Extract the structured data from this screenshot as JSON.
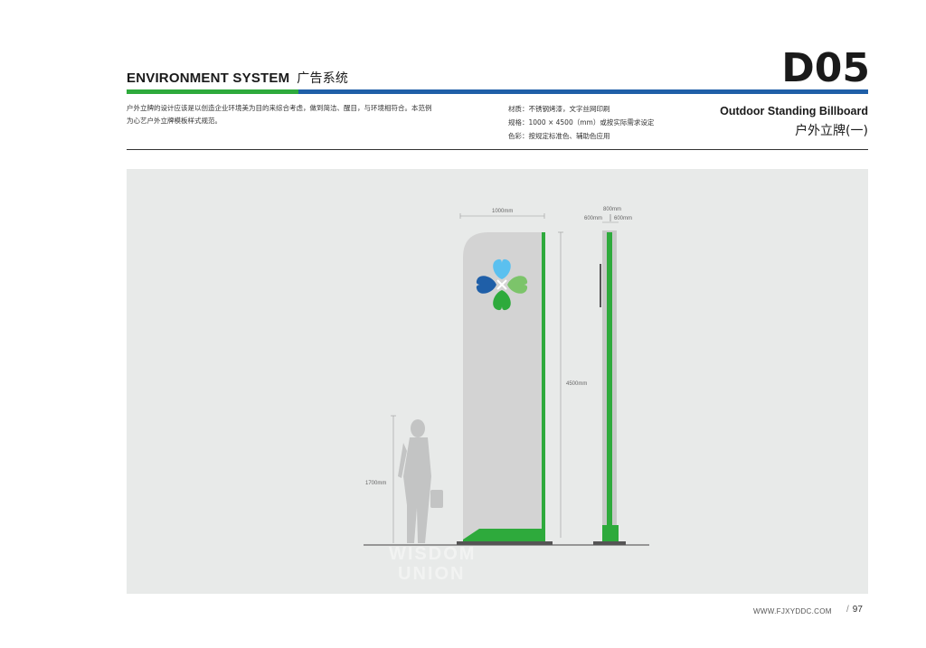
{
  "header": {
    "title": "ENVIRONMENT SYSTEM",
    "title_cn": "广告系统",
    "code": "D05"
  },
  "colors": {
    "green": "#2eaa3c",
    "blue": "#1f5fa8",
    "panel": "#e8eae9",
    "board": "#d3d3d3"
  },
  "description": {
    "line1": "户外立牌的设计应该是以创造企业环境美为目的来综合考虑，做到简洁、醒目，与环境相符合。本范例",
    "line2": "为心艺户外立牌模板样式规范。"
  },
  "specs": {
    "material": "材质：不锈钢烤漆，文字丝网印刷",
    "size": "规格：1000 × 4500（mm）或按实际需求设定",
    "color": "色彩：按规定标准色、辅助色应用"
  },
  "title": {
    "en": "Outdoor Standing Billboard",
    "cn": "户外立牌(一)"
  },
  "drawing": {
    "width_label": "1000mm",
    "height_label": "4500mm",
    "person_label": "1700mm",
    "depth_label": "800mm",
    "side_left_label": "600mm",
    "side_right_label": "600mm",
    "watermark_line1": "WISDOM",
    "watermark_line2": "UNION"
  },
  "icons": {
    "logo": "four-heart-clover-logo",
    "person": "businessman-silhouette"
  },
  "footer": {
    "url": "WWW.FJXYDDC.COM",
    "page": "97"
  }
}
